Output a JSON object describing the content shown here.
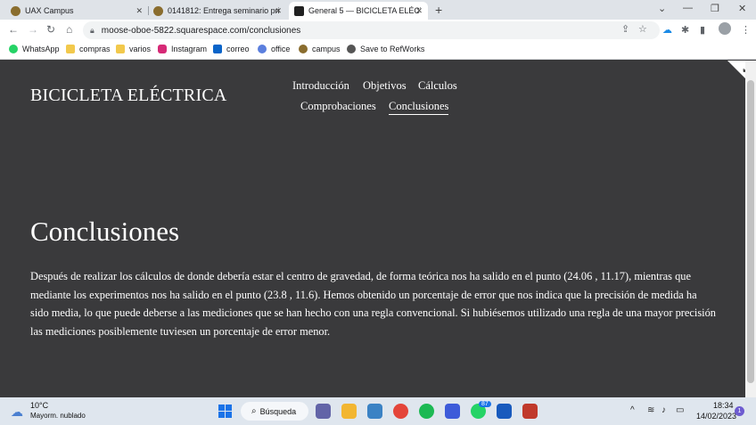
{
  "browser": {
    "tabs": [
      {
        "title": "UAX Campus",
        "close": "✕"
      },
      {
        "title": "0141812: Entrega seminario prim",
        "close": "✕"
      },
      {
        "title": "General 5 — BICICLETA ELÉCTRIC",
        "close": "✕"
      }
    ],
    "new_tab": "+",
    "url": "moose-oboe-5822.squarespace.com/conclusiones",
    "bookmarks": [
      "WhatsApp",
      "compras",
      "varios",
      "Instagram",
      "correo",
      "office",
      "campus",
      "Save to RefWorks"
    ]
  },
  "site": {
    "title": "BICICLETA ELÉCTRICA",
    "nav": [
      "Introducción",
      "Objetivos",
      "Cálculos",
      "Comprobaciones",
      "Conclusiones"
    ],
    "active_nav": "Conclusiones",
    "heading": "Conclusiones",
    "paragraph": "Después de realizar los cálculos de donde debería estar el centro de gravedad, de forma teórica nos ha salido en el punto (24.06 , 11.17), mientras que mediante los experimentos nos ha salido en el punto (23.8 , 11.6). Hemos obtenido un porcentaje de error que nos indica que la precisión de medida ha sido media, lo que puede deberse a las mediciones que se han hecho con una regla convencional. Si hubiésemos utilizado una regla de una mayor precisión las mediciones posiblemente tuviesen un porcentaje de error menor."
  },
  "taskbar": {
    "weather_temp": "10°C",
    "weather_desc": "Mayorm. nublado",
    "search_label": "Búsqueda",
    "whatsapp_badge": "87",
    "time": "18:34",
    "date": "14/02/2023",
    "notification_count": "1"
  },
  "colors": {
    "page_bg": "#3a3a3c",
    "text": "#ffffff",
    "tabstrip": "#dfe3e8",
    "taskbar": "#dfe6ee"
  }
}
